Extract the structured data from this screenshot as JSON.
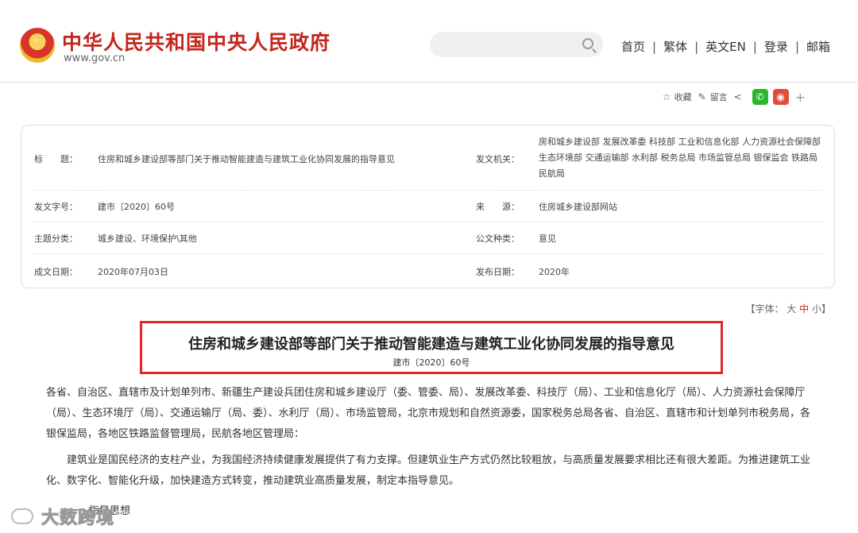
{
  "header": {
    "site_title": "中华人民共和国中央人民政府",
    "site_domain": "www.gov.cn",
    "search_placeholder": "",
    "nav": [
      "首页",
      "繁体",
      "英文EN",
      "登录",
      "邮箱"
    ]
  },
  "share": {
    "favorite": "收藏",
    "comment": "留言",
    "wechat_icon": "wechat-icon",
    "weibo_icon": "weibo-icon",
    "more": "+"
  },
  "info": {
    "title_label": "标　　题：",
    "title_value": "住房和城乡建设部等部门关于推动智能建造与建筑工业化协同发展的指导意见",
    "issuer_label": "发文机关：",
    "issuer_value": "房和城乡建设部 发展改革委 科技部 工业和信息化部 人力资源社会保障部 生态环境部 交通运输部 水利部 税务总局 市场监管总局 银保监会 铁路局 民航局",
    "docno_label": "发文字号：",
    "docno_value": "建市〔2020〕60号",
    "source_label": "来　　源：",
    "source_value": "住房城乡建设部网站",
    "topic_label": "主题分类：",
    "topic_value": "城乡建设、环境保护\\其他",
    "type_label": "公文种类：",
    "type_value": "意见",
    "date_label": "成文日期：",
    "date_value": "2020年07月03日",
    "pub_label": "发布日期：",
    "pub_value": "2020年"
  },
  "fontsize": {
    "prefix": "【字体：",
    "large": "大",
    "medium": "中",
    "small": "小",
    "suffix": "】"
  },
  "document": {
    "title": "住房和城乡建设部等部门关于推动智能建造与建筑工业化协同发展的指导意见",
    "number": "建市〔2020〕60号",
    "para1": "各省、自治区、直辖市及计划单列市、新疆生产建设兵团住房和城乡建设厅（委、管委、局）、发展改革委、科技厅（局）、工业和信息化厅（局）、人力资源社会保障厅（局）、生态环境厅（局）、交通运输厅（局、委）、水利厅（局）、市场监管局，北京市规划和自然资源委，国家税务总局各省、自治区、直辖市和计划单列市税务局，各银保监局，各地区铁路监督管理局，民航各地区管理局：",
    "para2": "建筑业是国民经济的支柱产业，为我国经济持续健康发展提供了有力支撑。但建筑业生产方式仍然比较粗放，与高质量发展要求相比还有很大差距。为推进建筑工业化、数字化、智能化升级，加快建造方式转变，推动建筑业高质量发展，制定本指导意见。",
    "section1": "一、指导思想"
  },
  "watermark": "大数跨境",
  "colors": {
    "brand_red": "#c4261d",
    "highlight_border": "#e02828",
    "wechat": "#2db42b",
    "weibo": "#e34a3c"
  }
}
